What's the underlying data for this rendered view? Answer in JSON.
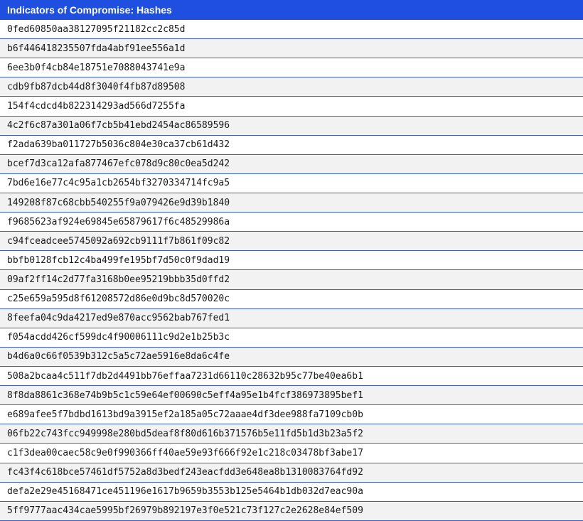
{
  "header": {
    "title": "Indicators of Compromise: Hashes",
    "color": "#1f4fe0"
  },
  "hashes": [
    "0fed60850aa38127095f21182cc2c85d",
    "b6f446418235507fda4abf91ee556a1d",
    "6ee3b0f4cb84e18751e7088043741e9a",
    "cdb9fb87dcb44d8f3040f4fb87d89508",
    "154f4cdcd4b822314293ad566d7255fa",
    "4c2f6c87a301a06f7cb5b41ebd2454ac86589596",
    "f2ada639ba011727b5036c804e30ca37cb61d432",
    "bcef7d3ca12afa877467efc078d9c80c0ea5d242",
    "7bd6e16e77c4c95a1cb2654bf3270334714fc9a5",
    "149208f87c68cbb540255f9a079426e9d39b1840",
    "f9685623af924e69845e65879617f6c48529986a",
    "c94fceadcee5745092a692cb9111f7b861f09c82",
    "bbfb0128fcb12c4ba499fe195bf7d50c0f9dad19",
    "09af2ff14c2d77fa3168b0ee95219bbb35d0ffd2",
    "c25e659a595d8f61208572d86e0d9bc8d570020c",
    "8feefa04c9da4217ed9e870acc9562bab767fed1",
    "f054acdd426cf599dc4f90006111c9d2e1b25b3c",
    "b4d6a0c66f0539b312c5a5c72ae5916e8da6c4fe",
    "508a2bcaa4c511f7db2d4491bb76effaa7231d66110c28632b95c77be40ea6b1",
    "8f8da8861c368e74b9b5c1c59e64ef00690c5eff4a95e1b4fcf386973895bef1",
    "e689afee5f7bdbd1613bd9a3915ef2a185a05c72aaae4df3dee988fa7109cb0b",
    "06fb22c743fcc949998e280bd5deaf8f80d616b371576b5e11fd5b1d3b23a5f2",
    "c1f3dea00caec58c9e0f990366ff40ae59e93f666f92e1c218c03478bf3abe17",
    "fc43f4c618bce57461df5752a8d3bedf243eacfdd3e648ea8b1310083764fd92",
    "defa2e29e45168471ce451196e1617b9659b3553b125e5464b1db032d7eac90a",
    "5ff9777aac434cae5995bf26979b892197e3f0e521c73f127c2e2628e84ef509"
  ]
}
